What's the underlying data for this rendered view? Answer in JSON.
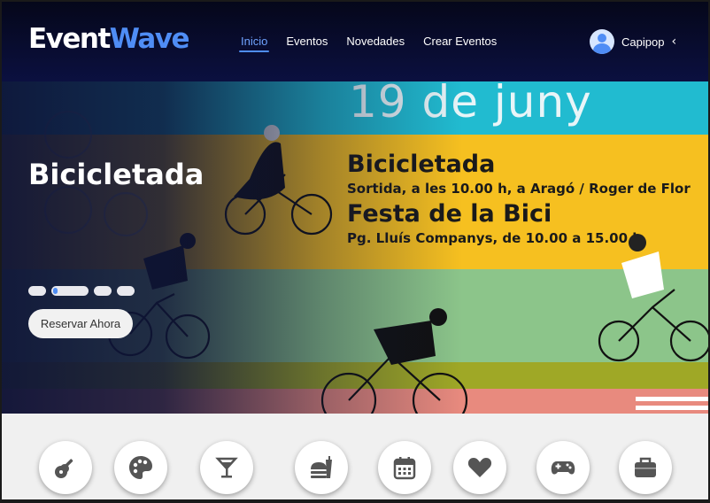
{
  "brand": {
    "name_part1": "Event",
    "name_part2": "Wave",
    "accent": "#4f8df5"
  },
  "nav": {
    "items": [
      {
        "label": "Inicio",
        "active": true
      },
      {
        "label": "Eventos",
        "active": false
      },
      {
        "label": "Novedades",
        "active": false
      },
      {
        "label": "Crear Eventos",
        "active": false
      }
    ]
  },
  "user": {
    "name": "Capipop",
    "avatar_icon": "user-avatar-icon",
    "toggle_icon": "chevron-left-icon"
  },
  "hero": {
    "title": "Bicicletada",
    "poster": {
      "date": "19 de juny",
      "line1": "Bicicletada",
      "line2": "Sortida, a les 10.00 h, a Aragó / Roger de Flor",
      "line3": "Festa de la Bici",
      "line4": "Pg. Lluís Companys, de 10.00 a 15.00 h"
    },
    "slides": 4,
    "active_slide": 2,
    "cta_label": "Reservar Ahora",
    "band_colors": [
      "#21bbd0",
      "#f6c020",
      "#8cc58a",
      "#9fa826",
      "#e88a7e"
    ]
  },
  "categories": [
    {
      "icon": "guitar-icon"
    },
    {
      "icon": "palette-icon"
    },
    {
      "icon": "cocktail-icon"
    },
    {
      "icon": "fast-food-icon"
    },
    {
      "icon": "calendar-icon"
    },
    {
      "icon": "heart-icon"
    },
    {
      "icon": "gamepad-icon"
    },
    {
      "icon": "briefcase-icon"
    }
  ]
}
